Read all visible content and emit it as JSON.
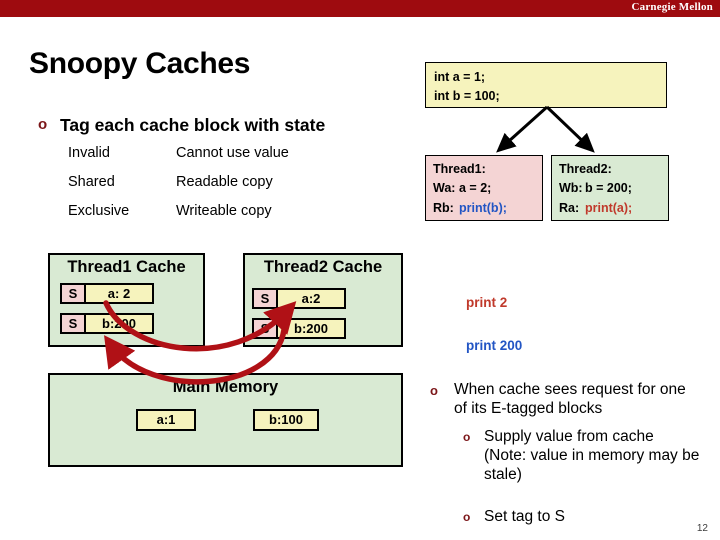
{
  "header": {
    "brand": "Carnegie Mellon",
    "band_color": "#9e0b0f"
  },
  "slide": {
    "title": "Snoopy Caches",
    "page_number": "12"
  },
  "bullets": {
    "tag_each": "Tag each cache block with state",
    "bullet_glyph": "o",
    "when_cache": "When cache sees request for one of its E-tagged blocks",
    "supply_value": "Supply value from cache (Note: value in memory may be stale)",
    "set_tag": "Set tag to S"
  },
  "state_table": {
    "rows": [
      {
        "state": "Invalid",
        "meaning": "Cannot use value"
      },
      {
        "state": "Shared",
        "meaning": "Readable copy"
      },
      {
        "state": "Exclusive",
        "meaning": "Writeable copy"
      }
    ]
  },
  "code_box": {
    "line1": "int a = 1;",
    "line2": "int b = 100;",
    "bg": "#f6f3bd"
  },
  "threads": {
    "thread1": {
      "title": "Thread1:",
      "bg": "#f4d4d4",
      "ops": [
        {
          "label": "Wa:",
          "code": "a = 2;",
          "color": "#000000"
        },
        {
          "label": "Rb:",
          "code": "print(b);",
          "color": "#2255c4"
        }
      ]
    },
    "thread2": {
      "title": "Thread2:",
      "bg": "#d9ead3",
      "ops": [
        {
          "label": "Wb:",
          "code": "b = 200;",
          "color": "#000000"
        },
        {
          "label": "Ra:",
          "code": "print(a);",
          "color": "#c0392b"
        }
      ]
    }
  },
  "diagram": {
    "cache1": {
      "title": "Thread1 Cache",
      "lines": [
        {
          "tag": "S",
          "value": "a: 2"
        },
        {
          "tag": "S",
          "value": "b:200"
        }
      ]
    },
    "cache2": {
      "title": "Thread2 Cache",
      "lines": [
        {
          "tag": "S",
          "value": "a:2"
        },
        {
          "tag": "S",
          "value": "b:200"
        }
      ]
    },
    "memory": {
      "title": "Main Memory",
      "cells": [
        {
          "value": "a:1"
        },
        {
          "value": "b:100"
        }
      ]
    },
    "box_fill": "#d9ead3",
    "tag_fill": "#f4d4d4",
    "value_fill": "#f6f3bd",
    "arrow_color": "#b01116"
  },
  "outputs": {
    "print_2": "print 2",
    "print_2_color": "#c0392b",
    "print_200": "print 200",
    "print_200_color": "#2255c4"
  }
}
